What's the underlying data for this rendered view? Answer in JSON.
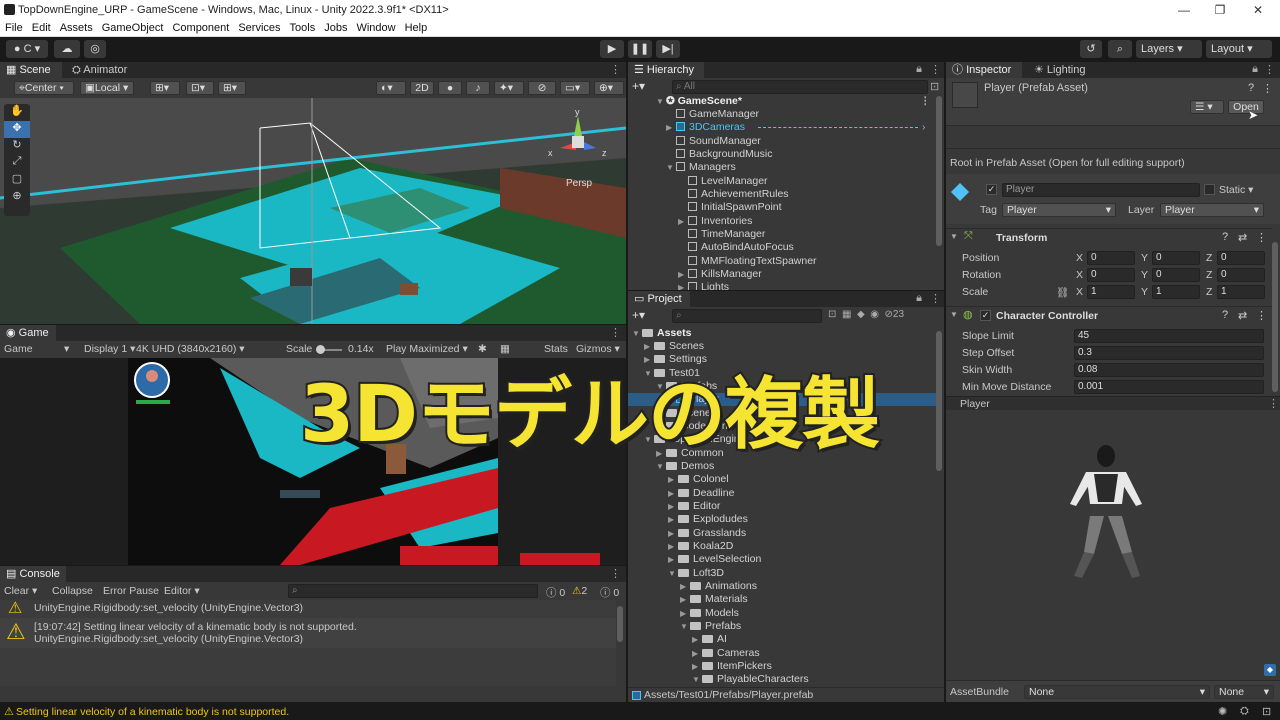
{
  "window": {
    "title": "TopDownEngine_URP - GameScene - Windows, Mac, Linux - Unity 2022.3.9f1* <DX11>"
  },
  "menu": [
    "File",
    "Edit",
    "Assets",
    "GameObject",
    "Component",
    "Services",
    "Tools",
    "Jobs",
    "Window",
    "Help"
  ],
  "toolbar": {
    "account": "C",
    "layers": "Layers",
    "layout": "Layout"
  },
  "scene": {
    "tab": "Scene",
    "tab2": "Animator",
    "pivot": "Center",
    "space": "Local",
    "mode2d": "2D",
    "persp": "Persp",
    "gizmo_y": "y",
    "gizmo_x": "x",
    "gizmo_z": "z"
  },
  "game": {
    "tab": "Game",
    "view": "Game",
    "display": "Display 1",
    "resolution": "4K UHD (3840x2160)",
    "scale_label": "Scale",
    "scale_value": "0.14x",
    "play_mode": "Play Maximized",
    "stats": "Stats",
    "gizmos": "Gizmos"
  },
  "hierarchy": {
    "tab": "Hierarchy",
    "search_placeholder": "All",
    "items": [
      "GameScene*",
      "GameManager",
      "3DCameras",
      "SoundManager",
      "BackgroundMusic",
      "Managers",
      "LevelManager",
      "AchievementRules",
      "InitialSpawnPoint",
      "Inventories",
      "TimeManager",
      "AutoBindAutoFocus",
      "MMFloatingTextSpawner",
      "KillsManager",
      "Lights"
    ]
  },
  "project": {
    "tab": "Project",
    "count": "23",
    "path": "Assets/Test01/Prefabs/Player.prefab",
    "items": [
      "Assets",
      "Scenes",
      "Settings",
      "Test01",
      "Prefabs",
      "Player",
      "Scenes",
      "CodeStone",
      "TopDownEngine",
      "Common",
      "Demos",
      "Colonel",
      "Deadline",
      "Editor",
      "Explodudes",
      "Grasslands",
      "Koala2D",
      "LevelSelection",
      "Loft3D",
      "Animations",
      "Materials",
      "Models",
      "Prefabs",
      "AI",
      "Cameras",
      "ItemPickers",
      "PlayableCharacters"
    ]
  },
  "console": {
    "tab": "Console",
    "clear": "Clear",
    "collapse": "Collapse",
    "error_pause": "Error Pause",
    "editor": "Editor",
    "count_info": "0",
    "count_warn": "2",
    "count_err": "0",
    "line_prev": "UnityEngine.Rigidbody:set_velocity (UnityEngine.Vector3)",
    "msg1": "[19:07:42] Setting linear velocity of a kinematic body is not supported.",
    "msg2": "UnityEngine.Rigidbody:set_velocity (UnityEngine.Vector3)"
  },
  "status": {
    "message": "Setting linear velocity of a kinematic body is not supported."
  },
  "inspector": {
    "tab": "Inspector",
    "tab2": "Lighting",
    "asset_title": "Player (Prefab Asset)",
    "open_button": "Open",
    "root_note": "Root in Prefab Asset (Open for full editing support)",
    "name": "Player",
    "static": "Static",
    "tag_label": "Tag",
    "tag": "Player",
    "layer_label": "Layer",
    "layer": "Player",
    "transform": {
      "title": "Transform",
      "rows": [
        {
          "label": "Position",
          "x": "0",
          "y": "0",
          "z": "0"
        },
        {
          "label": "Rotation",
          "x": "0",
          "y": "0",
          "z": "0"
        },
        {
          "label": "Scale",
          "x": "1",
          "y": "1",
          "z": "1"
        }
      ]
    },
    "cc": {
      "title": "Character Controller",
      "rows": [
        {
          "label": "Slope Limit",
          "value": "45"
        },
        {
          "label": "Step Offset",
          "value": "0.3"
        },
        {
          "label": "Skin Width",
          "value": "0.08"
        },
        {
          "label": "Min Move Distance",
          "value": "0.001"
        }
      ]
    },
    "preview_label": "Player",
    "assetbundle_label": "AssetBundle",
    "assetbundle": "None",
    "variant": "None"
  },
  "overlay": {
    "caption": "3Dモデルの複製"
  },
  "colors": {
    "accent_blue": "#4fc3f7",
    "caption_yellow": "#f5e431",
    "teal_floor": "#1ab7c4"
  }
}
